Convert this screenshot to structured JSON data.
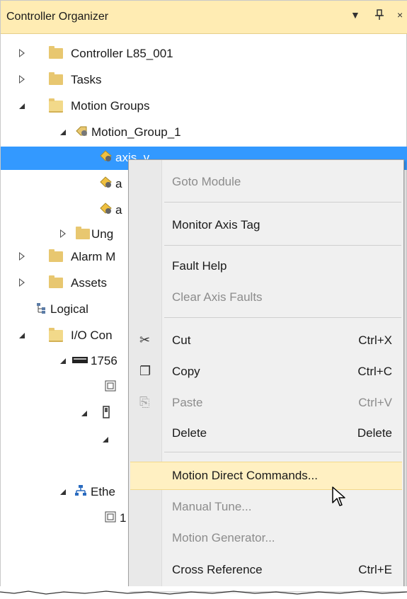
{
  "panel": {
    "title": "Controller Organizer",
    "pin_glyph": "⯈",
    "dropdown_glyph": "▼"
  },
  "tree": {
    "controller": "Controller L85_001",
    "tasks": "Tasks",
    "motion_groups": "Motion Groups",
    "motion_group_1": "Motion_Group_1",
    "axis_selected": "axis_v",
    "axis_2_partial": "a",
    "axis_3_partial": "a",
    "ungrouped_partial": "Ung",
    "alarm_partial": "Alarm M",
    "assets": "Assets",
    "logical_partial": "Logical",
    "io_partial": "I/O Con",
    "chassis_partial": "1756",
    "ethernet_partial": "Ethe",
    "eth_child_partial": "1"
  },
  "menu": {
    "items": [
      {
        "label": "Goto Module",
        "shortcut": "",
        "disabled": true
      },
      {
        "label": "Monitor Axis Tag",
        "shortcut": "",
        "disabled": false
      },
      {
        "label": "Fault Help",
        "shortcut": "",
        "disabled": false
      },
      {
        "label": "Clear Axis Faults",
        "shortcut": "",
        "disabled": true
      },
      {
        "label": "Cut",
        "shortcut": "Ctrl+X",
        "disabled": false,
        "icon": "✂"
      },
      {
        "label": "Copy",
        "shortcut": "Ctrl+C",
        "disabled": false,
        "icon": "❐"
      },
      {
        "label": "Paste",
        "shortcut": "Ctrl+V",
        "disabled": true,
        "icon": "⎘"
      },
      {
        "label": "Delete",
        "shortcut": "Delete",
        "disabled": false
      },
      {
        "label": "Motion Direct Commands...",
        "shortcut": "",
        "disabled": false,
        "highlighted": true
      },
      {
        "label": "Manual Tune...",
        "shortcut": "",
        "disabled": true
      },
      {
        "label": "Motion Generator...",
        "shortcut": "",
        "disabled": true
      },
      {
        "label": "Cross Reference",
        "shortcut": "Ctrl+E",
        "disabled": false
      }
    ]
  }
}
